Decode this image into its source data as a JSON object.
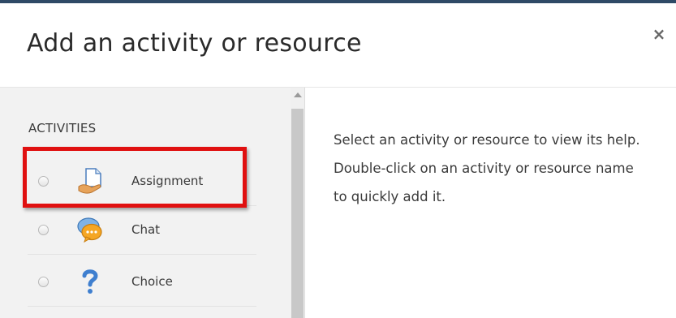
{
  "modal": {
    "title": "Add an activity or resource",
    "close_symbol": "×"
  },
  "options": {
    "section_heading": "ACTIVITIES",
    "items": [
      {
        "label": "Assignment",
        "icon": "assignment-icon",
        "selected": false,
        "highlighted": true
      },
      {
        "label": "Chat",
        "icon": "chat-icon",
        "selected": false,
        "highlighted": false
      },
      {
        "label": "Choice",
        "icon": "choice-icon",
        "selected": false,
        "highlighted": false
      }
    ]
  },
  "help": {
    "text": "Select an activity or resource to view its help. Double-click on an activity or resource name to quickly add it."
  },
  "colors": {
    "top_bar": "#2f4a66",
    "highlight": "#e01010",
    "panel_bg": "#f2f2f2"
  }
}
